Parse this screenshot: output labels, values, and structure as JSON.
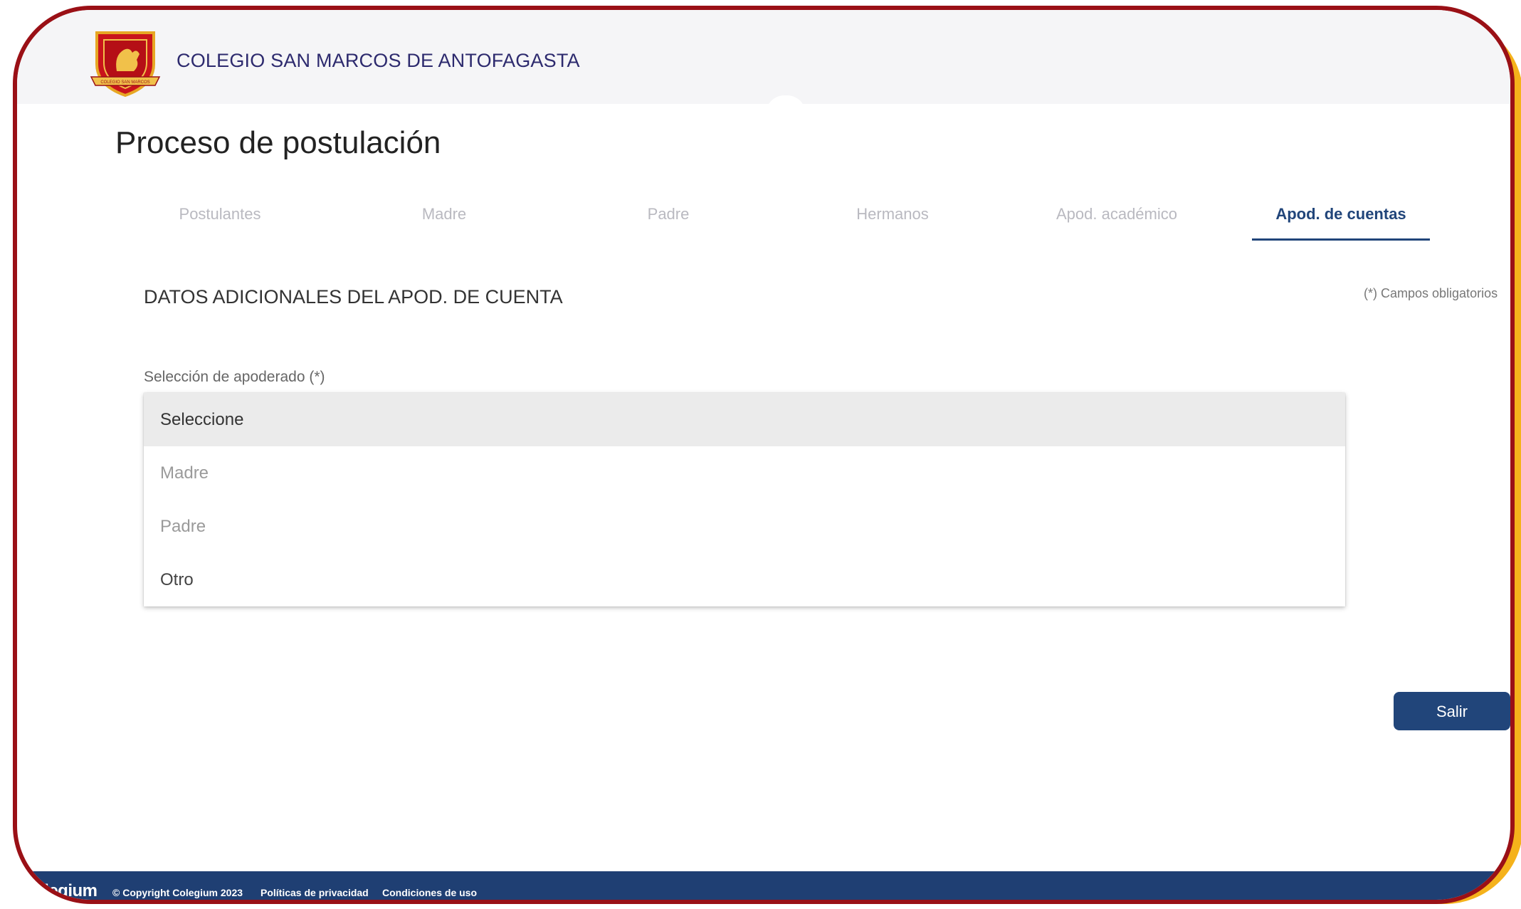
{
  "header": {
    "school_name": "COLEGIO SAN MARCOS DE ANTOFAGASTA",
    "logo_icon": "school-crest-icon",
    "logo_banner_text": "COLEGIO SAN MARCOS"
  },
  "page": {
    "title": "Proceso de postulación"
  },
  "tabs": [
    {
      "label": "Postulantes",
      "active": false
    },
    {
      "label": "Madre",
      "active": false
    },
    {
      "label": "Padre",
      "active": false
    },
    {
      "label": "Hermanos",
      "active": false
    },
    {
      "label": "Apod. académico",
      "active": false
    },
    {
      "label": "Apod. de cuentas",
      "active": true
    }
  ],
  "section": {
    "title": "DATOS ADICIONALES DEL APOD. DE CUENTA",
    "required_note": "(*) Campos obligatorios"
  },
  "form": {
    "guardian_select": {
      "label": "Selección de apoderado (*)",
      "options": [
        "Seleccione",
        "Madre",
        "Padre",
        "Otro"
      ],
      "selected": "Seleccione"
    }
  },
  "actions": {
    "exit_label": "Salir"
  },
  "footer": {
    "brand": "olegium",
    "copyright": "© Copyright Colegium 2023",
    "privacy": "Políticas de privacidad",
    "terms": "Condiciones de uso"
  },
  "colors": {
    "primary": "#21457a",
    "frame": "#9a1016",
    "accent_yellow": "#f5b21b",
    "footer": "#1f3f73"
  }
}
